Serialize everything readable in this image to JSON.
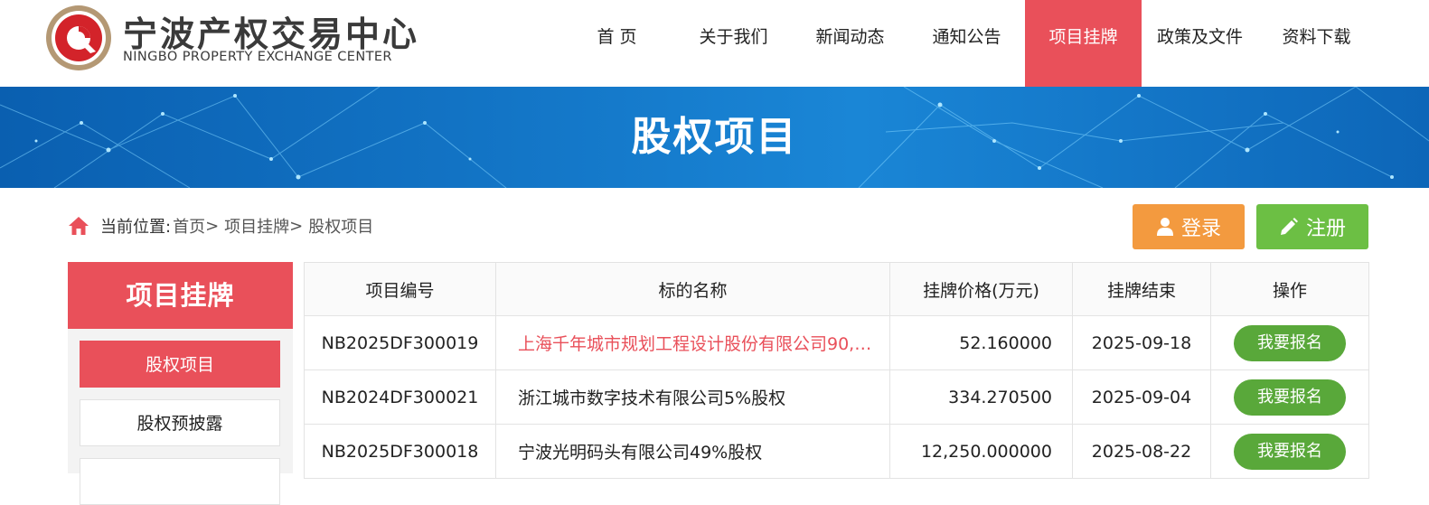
{
  "logo": {
    "cn": "宁波产权交易中心",
    "en": "NINGBO PROPERTY EXCHANGE CENTER",
    "icon": "logo-ring-icon"
  },
  "nav": [
    {
      "label": "首 页",
      "active": false
    },
    {
      "label": "关于我们",
      "active": false
    },
    {
      "label": "新闻动态",
      "active": false
    },
    {
      "label": "通知公告",
      "active": false
    },
    {
      "label": "项目挂牌",
      "active": true
    },
    {
      "label": "政策及文件",
      "active": false
    },
    {
      "label": "资料下载",
      "active": false
    }
  ],
  "banner": {
    "title": "股权项目"
  },
  "breadcrumb": {
    "label": "当前位置:",
    "items": [
      "首页",
      "项目挂牌",
      "股权项目"
    ],
    "sep": ">"
  },
  "auth": {
    "login": "登录",
    "register": "注册"
  },
  "sidebar": {
    "title": "项目挂牌",
    "items": [
      {
        "label": "股权项目",
        "active": true
      },
      {
        "label": "股权预披露",
        "active": false
      },
      {
        "label": "",
        "active": false
      }
    ]
  },
  "table": {
    "headers": [
      "项目编号",
      "标的名称",
      "挂牌价格(万元)",
      "挂牌结束",
      "操作"
    ],
    "rows": [
      {
        "code": "NB2025DF300019",
        "name": "上海千年城市规划工程设计股份有限公司90,…",
        "price": "52.160000",
        "end": "2025-09-18",
        "action": "我要报名",
        "hot": true
      },
      {
        "code": "NB2024DF300021",
        "name": "浙江城市数字技术有限公司5%股权",
        "price": "334.270500",
        "end": "2025-09-04",
        "action": "我要报名",
        "hot": false
      },
      {
        "code": "NB2025DF300018",
        "name": "宁波光明码头有限公司49%股权",
        "price": "12,250.000000",
        "end": "2025-08-22",
        "action": "我要报名",
        "hot": false
      }
    ]
  },
  "colors": {
    "accent": "#e9505a",
    "login": "#f39a3f",
    "register": "#6cbf44",
    "apply": "#59a83a",
    "banner": "#1478c9"
  }
}
